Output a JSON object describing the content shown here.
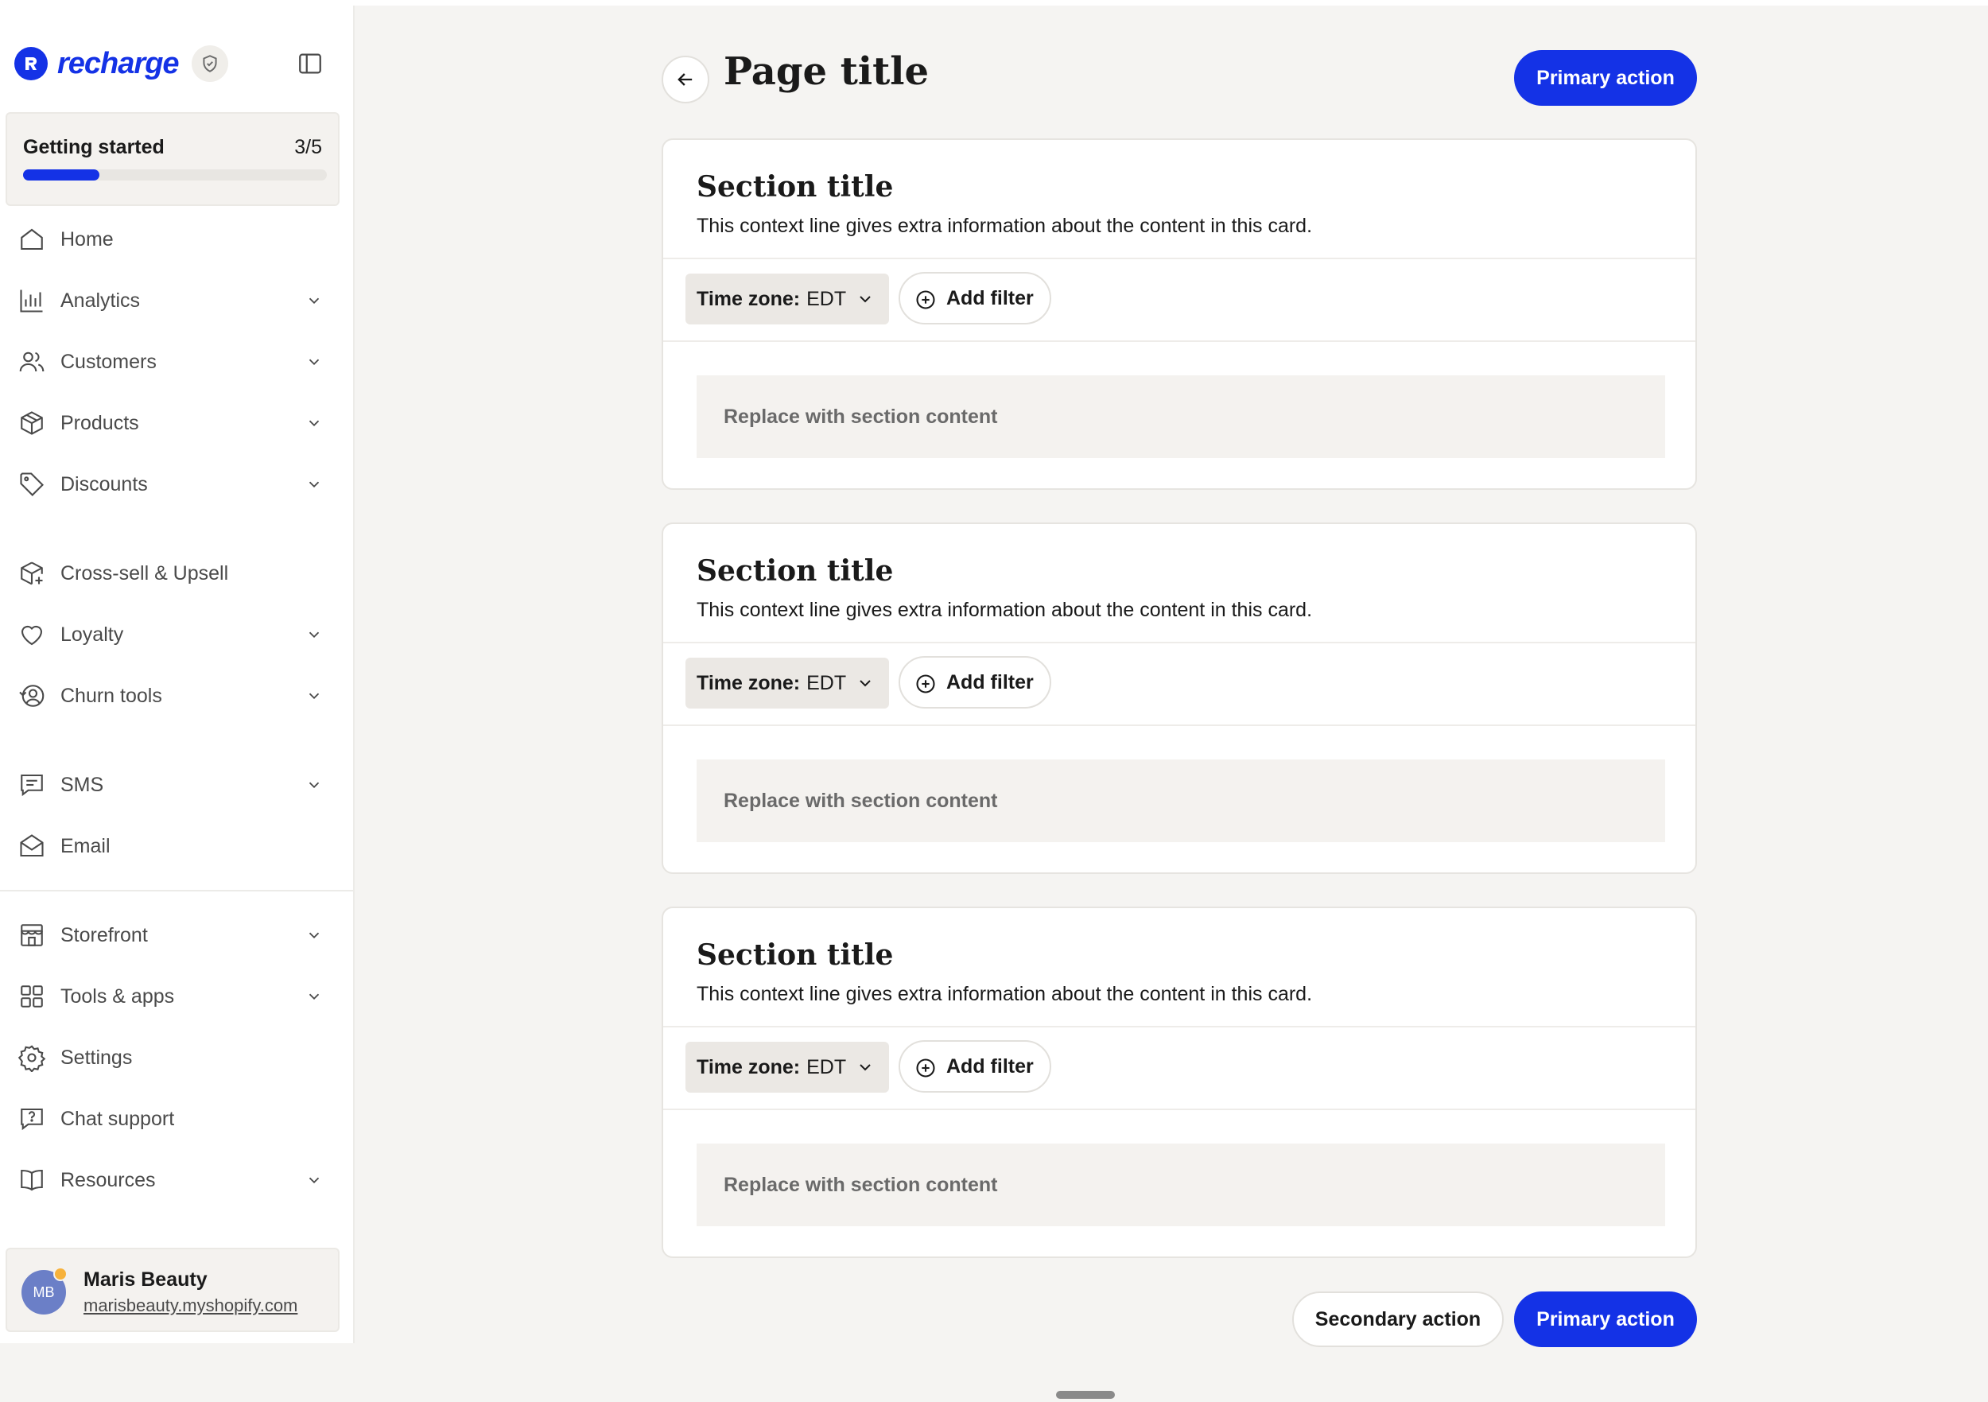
{
  "brand": {
    "name": "recharge"
  },
  "getting_started": {
    "label": "Getting started",
    "count": "3/5",
    "progress": 0.25
  },
  "nav": {
    "home": "Home",
    "analytics": "Analytics",
    "customers": "Customers",
    "products": "Products",
    "discounts": "Discounts",
    "cross_sell": "Cross-sell & Upsell",
    "loyalty": "Loyalty",
    "churn_tools": "Churn tools",
    "sms": "SMS",
    "email": "Email",
    "storefront": "Storefront",
    "tools_apps": "Tools & apps",
    "settings": "Settings",
    "chat_support": "Chat support",
    "resources": "Resources"
  },
  "account": {
    "initials": "MB",
    "name": "Maris Beauty",
    "url": "marisbeauty.myshopify.com"
  },
  "page": {
    "title": "Page title",
    "primary_action": "Primary action"
  },
  "cards": [
    {
      "title": "Section title",
      "context": "This context line gives extra information about the content in this card.",
      "timezone_label": "Time zone:",
      "timezone_value": "EDT",
      "add_filter": "Add filter",
      "content": "Replace with section content"
    },
    {
      "title": "Section title",
      "context": "This context line gives extra information about the content in this card.",
      "timezone_label": "Time zone:",
      "timezone_value": "EDT",
      "add_filter": "Add filter",
      "content": "Replace with section content"
    },
    {
      "title": "Section title",
      "context": "This context line gives extra information about the content in this card.",
      "timezone_label": "Time zone:",
      "timezone_value": "EDT",
      "add_filter": "Add filter",
      "content": "Replace with section content"
    }
  ],
  "footer": {
    "secondary_action": "Secondary action",
    "primary_action": "Primary action"
  },
  "colors": {
    "accent": "#1432e6",
    "background": "#f5f4f2",
    "surface": "#ffffff",
    "muted_fill": "#f4f2ef",
    "status_dot": "#f7b23b"
  }
}
